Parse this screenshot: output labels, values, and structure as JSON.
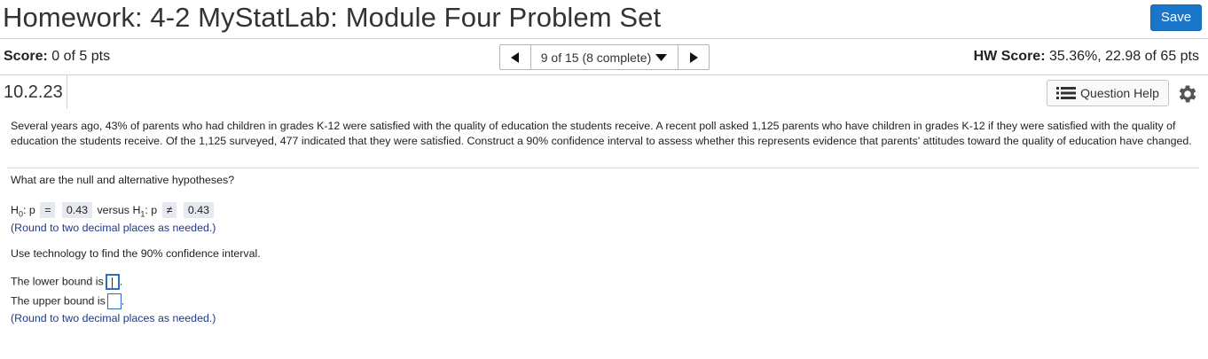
{
  "header": {
    "title": "Homework: 4-2 MyStatLab: Module Four Problem Set",
    "save_label": "Save"
  },
  "score_bar": {
    "score_label": "Score:",
    "score_value": "0 of 5 pts",
    "pager_text": "9 of 15 (8 complete)",
    "hw_label": "HW Score:",
    "hw_value": "35.36%, 22.98 of 65 pts"
  },
  "question": {
    "id": "10.2.23",
    "help_label": "Question Help",
    "problem": "Several years ago, 43% of parents who had children in grades K-12 were satisfied with the quality of education the students receive. A recent poll asked 1,125 parents who have children in grades K-12 if they were satisfied with the quality of education the students receive. Of the 1,125 surveyed, 477 indicated that they were satisfied. Construct a 90% confidence interval to assess whether this represents evidence that parents' attitudes toward the quality of education have changed.",
    "hypotheses_prompt": "What are the null and alternative hypotheses?",
    "h0_letter": "H",
    "h0_sub": "0",
    "h0_param": ": p",
    "h0_op": "=",
    "h0_value": "0.43",
    "versus": "versus",
    "h1_letter": "H",
    "h1_sub": "1",
    "h1_param": ": p",
    "h1_op": "≠",
    "h1_value": "0.43",
    "round_hint": "(Round to two decimal places as needed.)",
    "tech_prompt": "Use technology to find the 90% confidence interval.",
    "lower_label": "The lower bound is",
    "upper_label": "The upper bound is",
    "lower_value": "",
    "upper_value": "",
    "round_hint_2": "(Round to two decimal places as needed.)",
    "period": "."
  },
  "icons": {
    "prev": "triangle-left-icon",
    "next": "triangle-right-icon",
    "dropdown": "triangle-down-icon",
    "help": "list-icon",
    "settings": "gear-icon"
  },
  "colors": {
    "accent": "#1a76c9",
    "hint": "#1f3a8a",
    "answer_box": "#e6e9ef",
    "input_border": "#2b6ec6"
  }
}
